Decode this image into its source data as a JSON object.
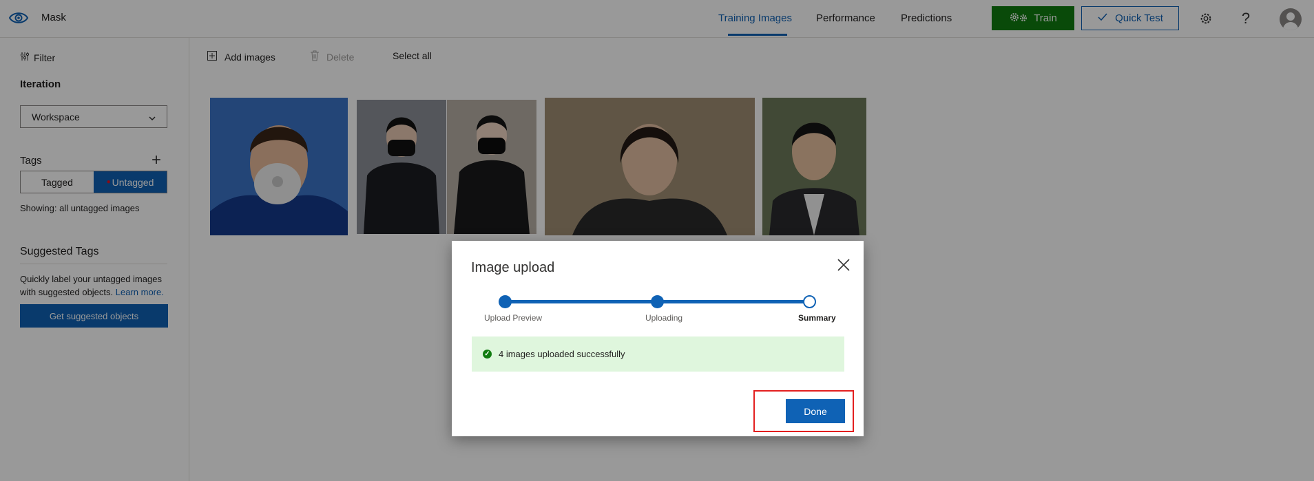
{
  "header": {
    "project_name": "Mask",
    "tabs": [
      {
        "label": "Training Images",
        "active": true
      },
      {
        "label": "Performance",
        "active": false
      },
      {
        "label": "Predictions",
        "active": false
      }
    ],
    "train_label": "Train",
    "quick_test_label": "Quick Test",
    "icons": [
      "eye-logo-icon",
      "gear-icon",
      "help-icon",
      "avatar"
    ]
  },
  "sidebar": {
    "filter_label": "Filter",
    "iteration_label": "Iteration",
    "iteration_value": "Workspace",
    "tags_label": "Tags",
    "tag_toggle": {
      "tagged": "Tagged",
      "untagged": "Untagged",
      "selected": "Untagged"
    },
    "showing_text": "Showing: all untagged images",
    "suggested_title": "Suggested Tags",
    "suggested_desc": "Quickly label your untagged images with suggested objects.",
    "learn_more": "Learn more.",
    "suggest_button": "Get suggested objects"
  },
  "toolbar": {
    "add_images": "Add images",
    "delete": "Delete",
    "select_all": "Select all"
  },
  "images": [
    {
      "name": "face-mask-3m-person"
    },
    {
      "name": "two-people-black-masks"
    },
    {
      "name": "woman-portrait"
    },
    {
      "name": "man-portrait"
    }
  ],
  "dialog": {
    "title": "Image upload",
    "steps": [
      {
        "label": "Upload Preview",
        "state": "done"
      },
      {
        "label": "Uploading",
        "state": "done"
      },
      {
        "label": "Summary",
        "state": "current"
      }
    ],
    "success_message": "4 images uploaded successfully",
    "done_button": "Done"
  },
  "colors": {
    "accent": "#0f62b5",
    "train_green": "#107c10",
    "success_bg": "#dff6dd",
    "highlight_red": "#e31f1f"
  }
}
